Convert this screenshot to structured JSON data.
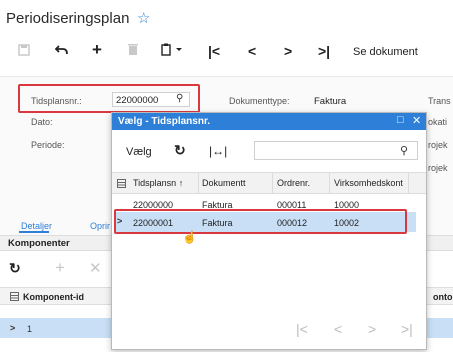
{
  "page": {
    "title": "Periodiseringsplan",
    "star_icon": "star-icon"
  },
  "toolbar": {
    "se_dokument": "Se dokument"
  },
  "form": {
    "tidsplansnr_label": "Tidsplansnr.:",
    "tidsplansnr_value": "22000000",
    "dato_label": "Dato:",
    "periode_label": "Periode:",
    "dokumenttype_label": "Dokumenttype:",
    "dokumenttype_value": "Faktura",
    "trans_label": "Trans",
    "lokati_label": "okati",
    "projek1_label": "rojek",
    "projek2_label": "rojek"
  },
  "tabs": {
    "detaljer": "Detaljer",
    "oprin": "Oprir"
  },
  "komponenter": {
    "title": "Komponenter",
    "col_komponent_id": "Komponent-id",
    "col_konto": "onto",
    "row_value": "1"
  },
  "modal": {
    "title": "Vælg - Tidsplansnr.",
    "select_label": "Vælg",
    "columns": [
      "Tidsplansn ↑",
      "Dokumentt",
      "Ordrenr.",
      "Virksomhedskont"
    ],
    "rows": [
      [
        "22000000",
        "Faktura",
        "000011",
        "10000"
      ],
      [
        "22000001",
        "Faktura",
        "000012",
        "10002"
      ]
    ]
  }
}
